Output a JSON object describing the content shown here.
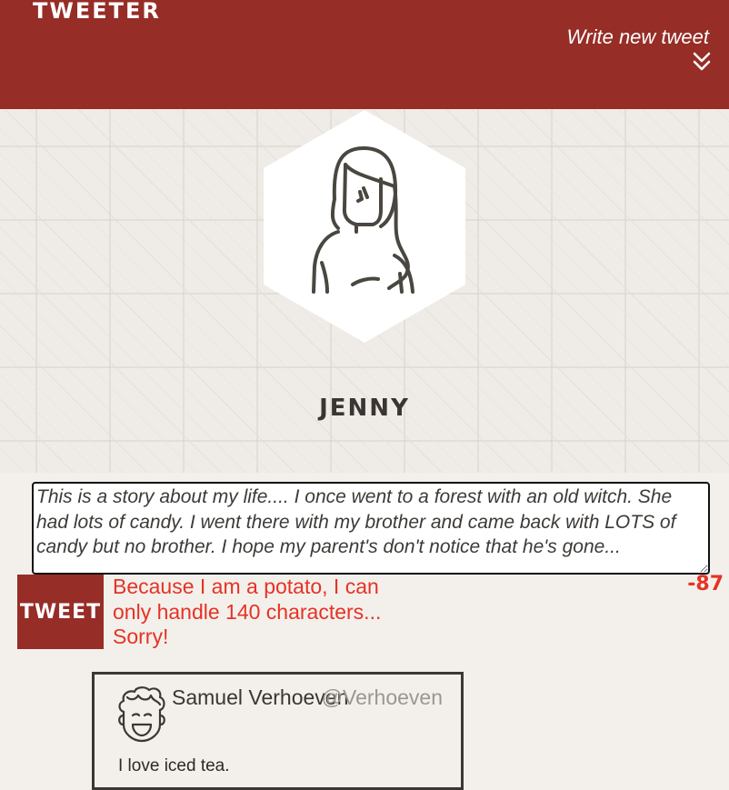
{
  "header": {
    "brand": "TWEETER",
    "write_new": "Write new tweet",
    "chevron_icon": "double-chevron-down-icon",
    "background": "#962d26"
  },
  "profile": {
    "name": "JENNY",
    "avatar_icon": "girl-avatar-icon"
  },
  "composer": {
    "text": "This is a story about my life.... I once went to a forest with an old witch. She had lots of candy. I went there with my brother and came back with LOTS of candy but no brother. I hope my parent's don't notice that he's gone...",
    "button_label": "TWEET",
    "error": "Because I am a potato, I can only handle 140 characters... Sorry!",
    "remaining": "-87",
    "error_color": "#e63226"
  },
  "feed": [
    {
      "name": "Samuel Verhoeven",
      "handle": "@Verhoeven",
      "text": "I love iced tea.",
      "avatar_icon": "curly-hair-avatar-icon"
    }
  ]
}
